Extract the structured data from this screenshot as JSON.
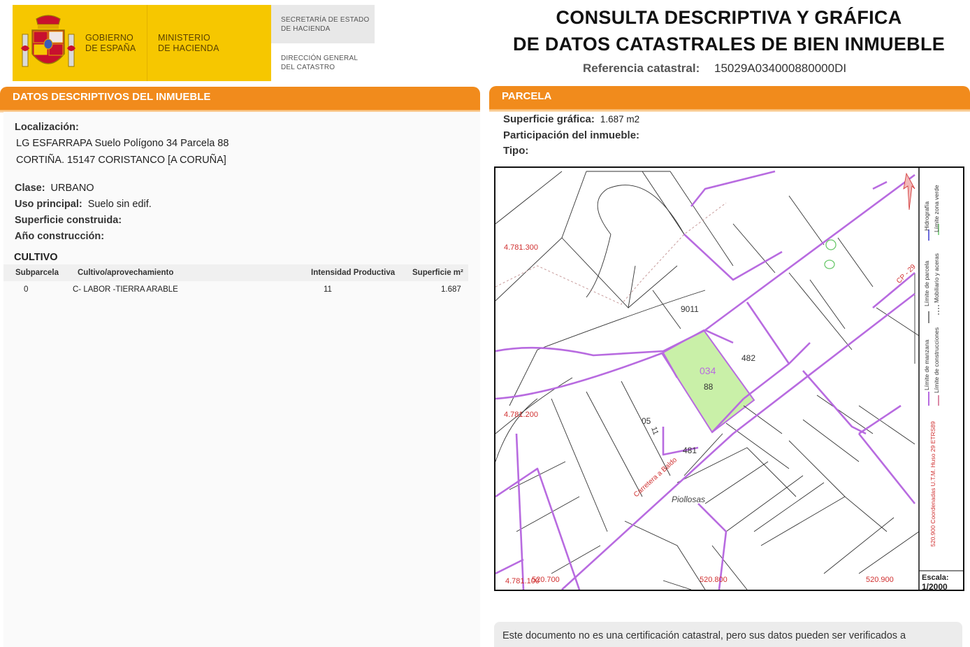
{
  "header": {
    "gov_line1": "GOBIERNO",
    "gov_line2": "DE ESPAÑA",
    "min_line1": "MINISTERIO",
    "min_line2": "DE HACIENDA",
    "sec_line1": "SECRETARÍA DE ESTADO",
    "sec_line2": "DE HACIENDA",
    "dir_line1": "DIRECCIÓN GENERAL",
    "dir_line2": "DEL CATASTRO",
    "title_line1": "CONSULTA DESCRIPTIVA Y GRÁFICA",
    "title_line2": "DE DATOS CATASTRALES DE BIEN INMUEBLE",
    "ref_label": "Referencia catastral:",
    "ref_value": "15029A034000880000DI",
    "brand_yellow": "#f6c700",
    "accent_orange": "#f18b1c"
  },
  "left": {
    "section_title": "DATOS DESCRIPTIVOS DEL INMUEBLE",
    "localizacion_label": "Localización:",
    "address_line1": "LG ESFARRAPA  Suelo Polígono 34 Parcela 88",
    "address_line2": "CORTIÑA. 15147 CORISTANCO [A CORUÑA]",
    "clase_label": "Clase:",
    "clase_value": "URBANO",
    "uso_label": "Uso principal:",
    "uso_value": "Suelo sin edif.",
    "superficie_label": "Superficie construida:",
    "anio_label": "Año construcción:",
    "cultivo_title": "CULTIVO",
    "table": {
      "headers": [
        "Subparcela",
        "Cultivo/aprovechamiento",
        "Intensidad Productiva",
        "Superficie m²"
      ],
      "rows": [
        [
          "0",
          "C- LABOR -TIERRA ARABLE",
          "11",
          "1.687"
        ]
      ]
    }
  },
  "right": {
    "section_title": "PARCELA",
    "sup_label": "Superficie gráfica:",
    "sup_value": "1.687 m2",
    "part_label": "Participación del inmueble:",
    "tipo_label": "Tipo:",
    "map": {
      "coord_labels": [
        "4.781.300",
        "4.781.200",
        "4.781.100",
        "520.700",
        "520.800",
        "520.900"
      ],
      "parcel_polygon": "034",
      "parcel_number": "88",
      "labels": [
        "9011",
        "482",
        "481",
        "05",
        "11",
        "Piollosas",
        "Carretera a Baldo",
        "CP - 29"
      ],
      "legend": [
        "Límite de manzana",
        "Límite de parcela",
        "Límite de construcciones",
        "Mobiliario y aceras",
        "Hidrografía",
        "Límite zona verde"
      ],
      "projection": "520.900 Coordenadas U.T.M. Huso 29 ETRS89",
      "scale_label": "Escala:",
      "scale_value": "1/2000",
      "colors": {
        "manzana": "#b86be0",
        "parcela": "#222222",
        "highlight": "#c9f0a8",
        "coords": "#d03030",
        "numbers": "#3a3acf",
        "zona_verde": "#69c86a"
      }
    },
    "footer_note": "Este documento no es una certificación catastral, pero sus datos pueden ser verificados a"
  }
}
